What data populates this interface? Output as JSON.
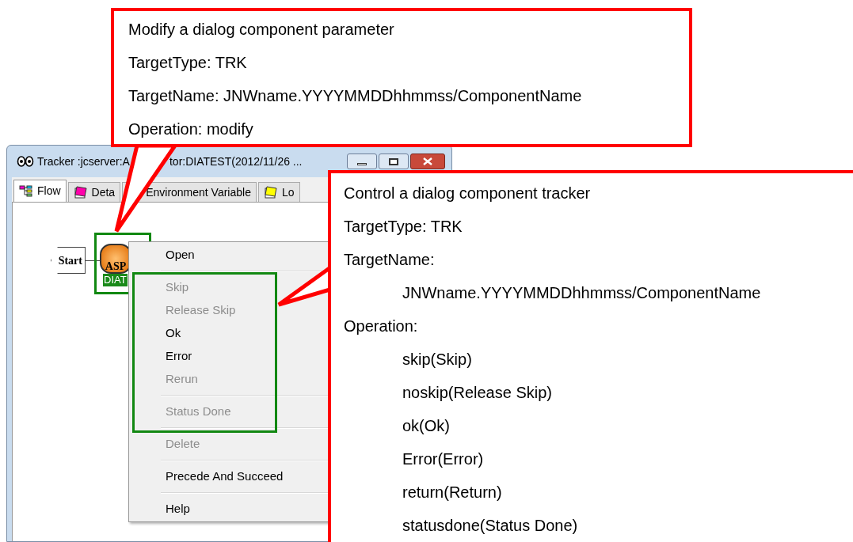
{
  "window": {
    "title_parts": [
      "Tracker :jcserver:A",
      "tor:DIATEST(2012/11/26 ..."
    ]
  },
  "tabs": [
    {
      "label": "Flow",
      "selected": true
    },
    {
      "label": "Deta",
      "selected": false
    },
    {
      "label": "Environment Variable",
      "selected": false
    },
    {
      "label": "Lo",
      "selected": false
    }
  ],
  "flow": {
    "start": "Start",
    "node_icon": "ASP",
    "node_label": "DIAT"
  },
  "context_menu": [
    {
      "label": "Open",
      "disabled": false
    },
    {
      "label": "Skip",
      "disabled": true
    },
    {
      "label": "Release Skip",
      "disabled": true
    },
    {
      "label": "Ok",
      "disabled": false
    },
    {
      "label": "Error",
      "disabled": false
    },
    {
      "label": "Rerun",
      "disabled": true
    },
    {
      "label": "Status Done",
      "disabled": true
    },
    {
      "label": "Delete",
      "disabled": true
    },
    {
      "label": "Precede And Succeed",
      "disabled": false
    },
    {
      "label": "Help",
      "disabled": false
    }
  ],
  "callout_modify": [
    {
      "text": "Modify a dialog component parameter"
    },
    {
      "text": "TargetType: TRK"
    },
    {
      "text": "TargetName: JNWname.YYYYMMDDhhmmss/ComponentName"
    },
    {
      "text": "Operation: modify"
    }
  ],
  "callout_control": [
    {
      "text": "Control a dialog component tracker"
    },
    {
      "text": "TargetType: TRK"
    },
    {
      "text": "TargetName:",
      "children": [
        "JNWname.YYYYMMDDhhmmss/ComponentName"
      ]
    },
    {
      "text": "Operation:",
      "children": [
        "skip(Skip)",
        "noskip(Release Skip)",
        "ok(Ok)",
        "Error(Error)",
        "return(Return)",
        "statusdone(Status Done)"
      ]
    }
  ]
}
